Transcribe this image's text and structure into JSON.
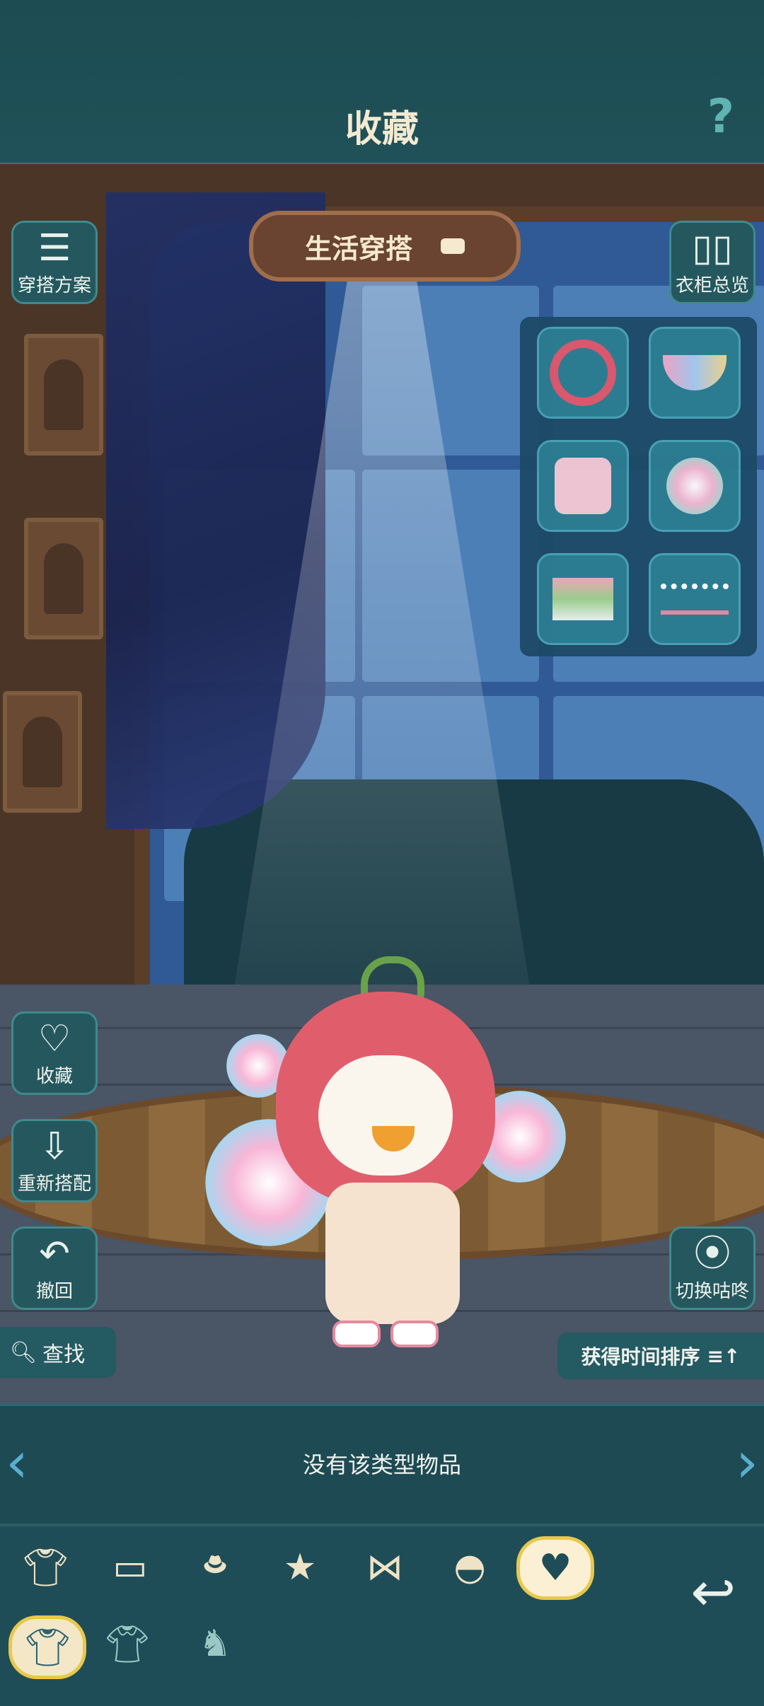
{
  "header": {
    "title": "收藏",
    "help_label": "?"
  },
  "outfit_selector": {
    "label": "生活穿搭"
  },
  "left_buttons": [
    {
      "label": "穿搭方案",
      "icon": "scroll-icon"
    },
    {
      "label": "收藏",
      "icon": "heart-icon"
    },
    {
      "label": "重新搭配",
      "icon": "remix-icon"
    },
    {
      "label": "撤回",
      "icon": "undo-icon"
    }
  ],
  "right_buttons": [
    {
      "label": "衣柜总览",
      "icon": "wardrobe-icon"
    },
    {
      "label": "切换咕咚",
      "icon": "cat-face-icon"
    }
  ],
  "equipped_items": [
    "headband",
    "collar",
    "top",
    "pinwheel-accessory",
    "skirt",
    "shoes"
  ],
  "search": {
    "label": "查找"
  },
  "sort": {
    "label": "获得时间排序"
  },
  "list": {
    "empty_message": "没有该类型物品"
  },
  "categories": [
    "top",
    "bottom",
    "hat",
    "necklace",
    "wings",
    "shoes",
    "favorite"
  ],
  "subcategories": [
    "set",
    "top-set",
    "scene"
  ]
}
